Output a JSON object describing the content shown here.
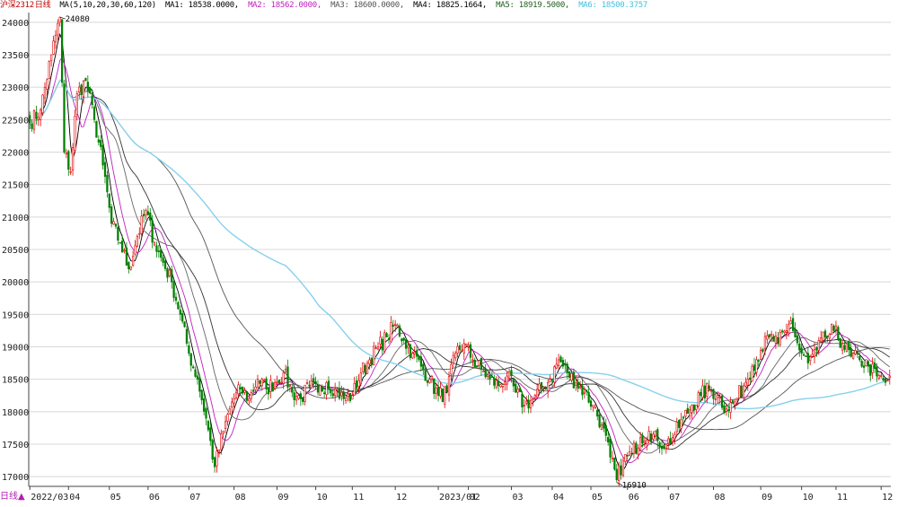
{
  "header": {
    "symbol": "沪深2312",
    "period": "日线",
    "ma_label": "MA(5,10,20,30,60,120)",
    "ma_values": [
      {
        "label": "MA1: 18538.0000,",
        "color": "#000000"
      },
      {
        "label": "MA2: 18562.0000,",
        "color": "#c020c0"
      },
      {
        "label": "MA3: 18600.0000,",
        "color": "#555555"
      },
      {
        "label": "MA4: 18825.1664,",
        "color": "#000000"
      },
      {
        "label": "MA5: 18919.5000,",
        "color": "#206020"
      },
      {
        "label": "MA6: 18500.3757",
        "color": "#40c0e0"
      }
    ]
  },
  "period_tab": "日线",
  "colors": {
    "up": "#e00000",
    "down": "#008000",
    "ma1": "#000000",
    "ma2": "#c020c0",
    "ma3": "#666666",
    "ma4": "#333333",
    "ma5": "#555555",
    "ma6": "#87d0ec",
    "grid": "#d8d8d8"
  },
  "chart_data": {
    "type": "candlestick",
    "ylim": [
      16850,
      24150
    ],
    "yticks": [
      17000,
      17500,
      18000,
      18500,
      19000,
      19500,
      20000,
      20500,
      21000,
      21500,
      22000,
      22500,
      23000,
      23500,
      24000
    ],
    "x_ticks": [
      {
        "label": "2022/03",
        "index": 0
      },
      {
        "label": "04",
        "index": 18
      },
      {
        "label": "05",
        "index": 37
      },
      {
        "label": "06",
        "index": 55
      },
      {
        "label": "07",
        "index": 74
      },
      {
        "label": "08",
        "index": 95
      },
      {
        "label": "09",
        "index": 115
      },
      {
        "label": "10",
        "index": 133
      },
      {
        "label": "11",
        "index": 150
      },
      {
        "label": "12",
        "index": 170
      },
      {
        "label": "2023/01",
        "index": 190
      },
      {
        "label": "02",
        "index": 204
      },
      {
        "label": "03",
        "index": 224
      },
      {
        "label": "04",
        "index": 243
      },
      {
        "label": "05",
        "index": 261
      },
      {
        "label": "06",
        "index": 278
      },
      {
        "label": "07",
        "index": 297
      },
      {
        "label": "08",
        "index": 318
      },
      {
        "label": "09",
        "index": 340
      },
      {
        "label": "10",
        "index": 359
      },
      {
        "label": "11",
        "index": 375
      },
      {
        "label": "12",
        "index": 396
      }
    ],
    "annotations": [
      {
        "text": "24080",
        "index": 14,
        "value": 24080
      },
      {
        "text": "16910",
        "index": 273,
        "value": 16910
      }
    ],
    "anchors": [
      [
        0,
        22450
      ],
      [
        5,
        22650
      ],
      [
        10,
        23500
      ],
      [
        14,
        24080
      ],
      [
        16,
        22000
      ],
      [
        19,
        21700
      ],
      [
        22,
        22900
      ],
      [
        26,
        23100
      ],
      [
        30,
        22500
      ],
      [
        34,
        21800
      ],
      [
        38,
        20900
      ],
      [
        42,
        20600
      ],
      [
        46,
        20200
      ],
      [
        50,
        20700
      ],
      [
        54,
        21100
      ],
      [
        58,
        20600
      ],
      [
        62,
        20300
      ],
      [
        66,
        20000
      ],
      [
        70,
        19500
      ],
      [
        74,
        18900
      ],
      [
        78,
        18500
      ],
      [
        82,
        17900
      ],
      [
        86,
        17150
      ],
      [
        90,
        17700
      ],
      [
        94,
        18150
      ],
      [
        98,
        18350
      ],
      [
        102,
        18200
      ],
      [
        106,
        18500
      ],
      [
        110,
        18350
      ],
      [
        114,
        18450
      ],
      [
        118,
        18600
      ],
      [
        122,
        18300
      ],
      [
        126,
        18200
      ],
      [
        130,
        18400
      ],
      [
        134,
        18300
      ],
      [
        138,
        18450
      ],
      [
        142,
        18350
      ],
      [
        146,
        18200
      ],
      [
        150,
        18250
      ],
      [
        154,
        18600
      ],
      [
        158,
        18800
      ],
      [
        162,
        19000
      ],
      [
        166,
        19150
      ],
      [
        170,
        19350
      ],
      [
        174,
        19100
      ],
      [
        178,
        18900
      ],
      [
        182,
        18700
      ],
      [
        186,
        18500
      ],
      [
        190,
        18250
      ],
      [
        194,
        18300
      ],
      [
        198,
        18900
      ],
      [
        202,
        19050
      ],
      [
        206,
        18800
      ],
      [
        210,
        18650
      ],
      [
        214,
        18500
      ],
      [
        218,
        18400
      ],
      [
        222,
        18550
      ],
      [
        226,
        18300
      ],
      [
        230,
        18100
      ],
      [
        234,
        18200
      ],
      [
        238,
        18350
      ],
      [
        242,
        18500
      ],
      [
        246,
        18800
      ],
      [
        250,
        18600
      ],
      [
        254,
        18450
      ],
      [
        258,
        18300
      ],
      [
        262,
        18100
      ],
      [
        266,
        17800
      ],
      [
        270,
        17300
      ],
      [
        273,
        16950
      ],
      [
        276,
        17250
      ],
      [
        280,
        17350
      ],
      [
        284,
        17600
      ],
      [
        288,
        17700
      ],
      [
        292,
        17550
      ],
      [
        296,
        17500
      ],
      [
        300,
        17650
      ],
      [
        304,
        17900
      ],
      [
        308,
        18100
      ],
      [
        312,
        18250
      ],
      [
        316,
        18350
      ],
      [
        320,
        18250
      ],
      [
        324,
        18050
      ],
      [
        328,
        18150
      ],
      [
        332,
        18400
      ],
      [
        336,
        18700
      ],
      [
        340,
        18950
      ],
      [
        344,
        19150
      ],
      [
        348,
        19050
      ],
      [
        352,
        19250
      ],
      [
        354,
        19400
      ],
      [
        358,
        18950
      ],
      [
        362,
        18750
      ],
      [
        366,
        18950
      ],
      [
        370,
        19150
      ],
      [
        374,
        19250
      ],
      [
        378,
        19050
      ],
      [
        382,
        18850
      ],
      [
        386,
        18800
      ],
      [
        390,
        18700
      ],
      [
        394,
        18550
      ],
      [
        398,
        18450
      ],
      [
        400,
        18550
      ]
    ],
    "n_bars": 401
  }
}
